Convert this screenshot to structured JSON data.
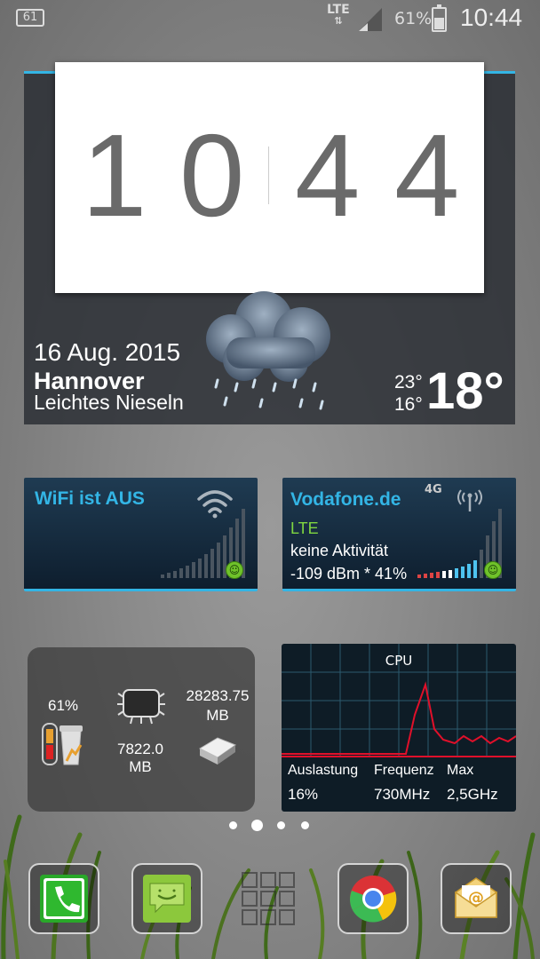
{
  "status_bar": {
    "notification_badge": "61",
    "network_type": "LTE",
    "network_arrows": "⇅",
    "battery_percent": "61%",
    "time": "10:44"
  },
  "clock_widget": {
    "digits": [
      "1",
      "0",
      "4",
      "4"
    ]
  },
  "weather": {
    "date": "16 Aug. 2015",
    "city": "Hannover",
    "condition": "Leichtes Nieseln",
    "high": "23°",
    "low": "16°",
    "current": "18°",
    "icon": "rain-cloud-icon"
  },
  "wifi_widget": {
    "title": "WiFi ist AUS",
    "icon": "wifi-icon"
  },
  "mobile_widget": {
    "title": "Vodafone.de",
    "network": "LTE",
    "activity": "keine Aktivität",
    "signal": "-109 dBm * 41%",
    "badge": "4G",
    "icon": "antenna-icon"
  },
  "system_widget": {
    "battery_percent": "61%",
    "ram_value": "7822.0",
    "ram_unit": "MB",
    "storage_value": "28283.75",
    "storage_unit": "MB"
  },
  "cpu_widget": {
    "title": "CPU",
    "load_label": "Auslastung",
    "load_value": "16%",
    "freq_label": "Frequenz",
    "freq_value": "730MHz",
    "max_label": "Max",
    "max_value": "2,5GHz"
  },
  "home_pages": {
    "count": 4,
    "active_index": 1
  },
  "dock": {
    "apps": [
      "phone-icon",
      "messaging-icon",
      "app-drawer-icon",
      "chrome-icon",
      "email-icon"
    ]
  },
  "colors": {
    "accent": "#33b5e5",
    "widget_dark": "#0e1e2e",
    "signal_green": "#6fc22a",
    "cpu_line": "#e0102a"
  }
}
